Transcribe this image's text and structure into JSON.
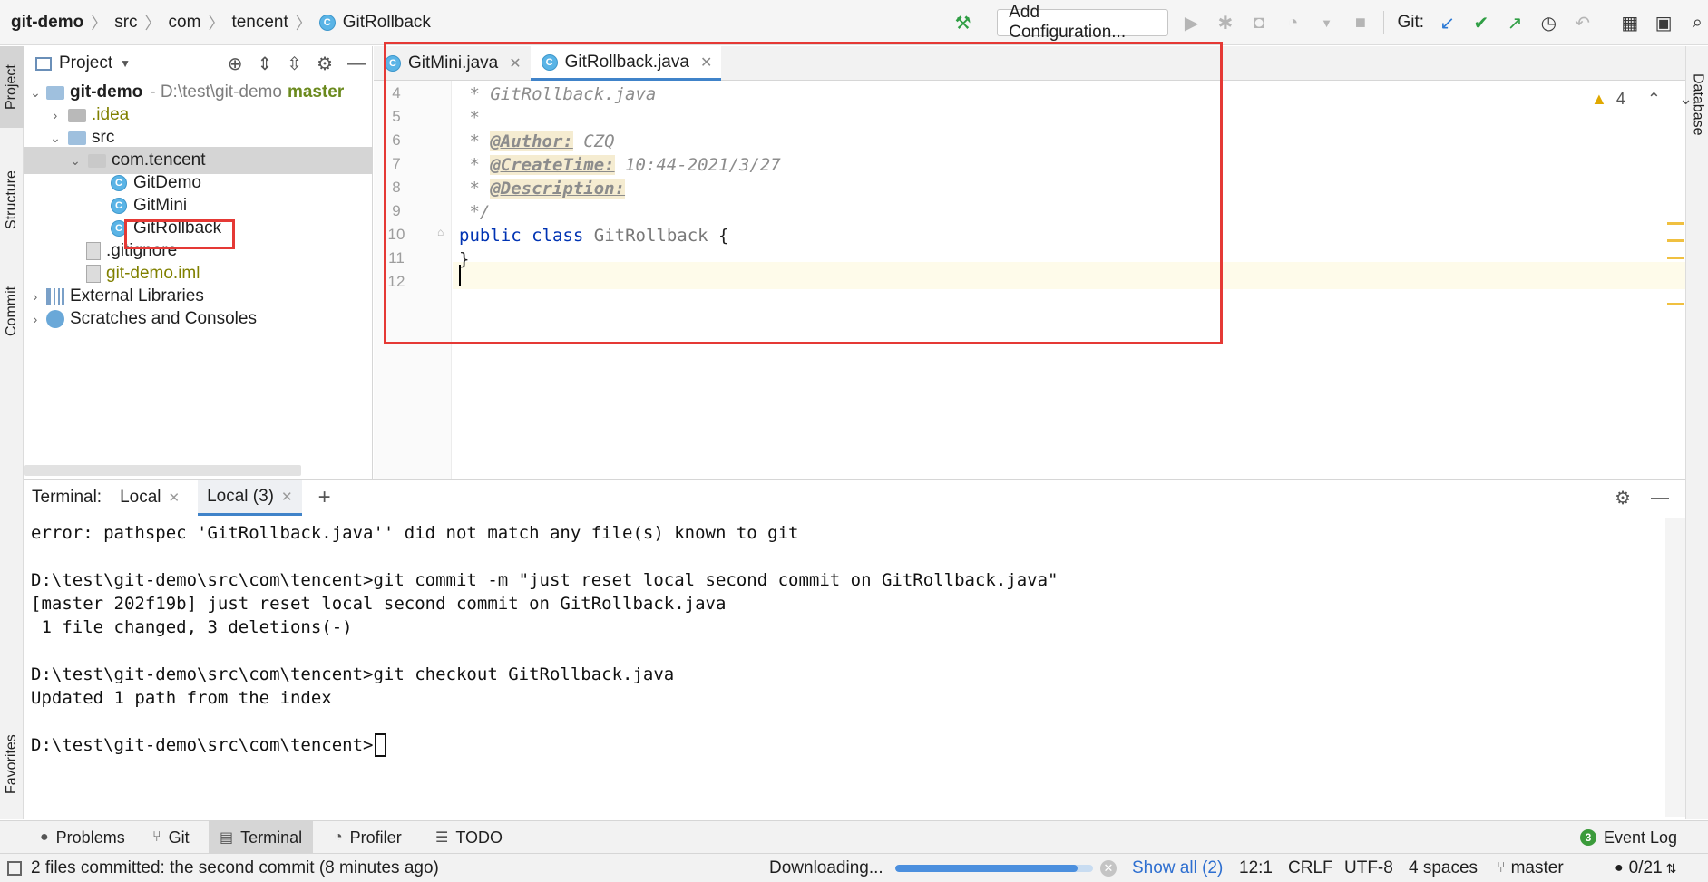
{
  "navbar": {
    "breadcrumb": [
      "git-demo",
      "src",
      "com",
      "tencent",
      "GitRollback"
    ],
    "add_configuration": "Add Configuration...",
    "git_label": "Git:"
  },
  "left_stripe": {
    "project": "Project",
    "structure": "Structure",
    "commit": "Commit",
    "favorites": "Favorites"
  },
  "right_stripe": {
    "database": "Database"
  },
  "project_panel": {
    "title": "Project",
    "root_name": "git-demo",
    "root_path": "- D:\\test\\git-demo",
    "root_branch": "master",
    "idea": ".idea",
    "src": "src",
    "package": "com.tencent",
    "classes": [
      "GitDemo",
      "GitMini",
      "GitRollback"
    ],
    "gitignore": ".gitignore",
    "iml": "git-demo.iml",
    "external_libraries": "External Libraries",
    "scratches": "Scratches and Consoles"
  },
  "editor": {
    "tabs": [
      "GitMini.java",
      "GitRollback.java"
    ],
    "warning_count": "4",
    "line_numbers": [
      "4",
      "5",
      "6",
      "7",
      "8",
      "9",
      "10",
      "11",
      "12"
    ],
    "code": {
      "l4": " * GitRollback.java",
      "l5": " *",
      "l6_prefix": " * ",
      "l6_tag": "@Author:",
      "l6_value": " CZQ",
      "l7_prefix": " * ",
      "l7_tag": "@CreateTime:",
      "l7_value": " 10:44-2021/3/27",
      "l8_prefix": " * ",
      "l8_tag": "@Description:",
      "l9": " */",
      "l10_kw1": "public",
      "l10_kw2": "class",
      "l10_name": "GitRollback",
      "l10_brace": "{",
      "l11": "}"
    }
  },
  "terminal": {
    "label": "Terminal:",
    "tabs": [
      "Local",
      "Local (3)"
    ],
    "lines": [
      "error: pathspec 'GitRollback.java'' did not match any file(s) known to git",
      "",
      "D:\\test\\git-demo\\src\\com\\tencent>git commit -m \"just reset local second commit on GitRollback.java\"",
      "[master 202f19b] just reset local second commit on GitRollback.java",
      " 1 file changed, 3 deletions(-)",
      "",
      "D:\\test\\git-demo\\src\\com\\tencent>git checkout GitRollback.java",
      "Updated 1 path from the index",
      ""
    ],
    "prompt": "D:\\test\\git-demo\\src\\com\\tencent>"
  },
  "tool_stripe": {
    "problems": "Problems",
    "git": "Git",
    "terminal": "Terminal",
    "profiler": "Profiler",
    "todo": "TODO",
    "event_log": "Event Log",
    "event_count": "3"
  },
  "status_bar": {
    "message": "2 files committed: the second commit (8 minutes ago)",
    "downloading": "Downloading...",
    "progress": 0.92,
    "show_all": "Show all (2)",
    "position": "12:1",
    "line_sep": "CRLF",
    "encoding": "UTF-8",
    "indent": "4 spaces",
    "branch": "master",
    "counter": "0/21"
  },
  "colors": {
    "accent": "#4083c9",
    "highlight_box": "#e53935",
    "class_icon": "#5ab4e6"
  }
}
